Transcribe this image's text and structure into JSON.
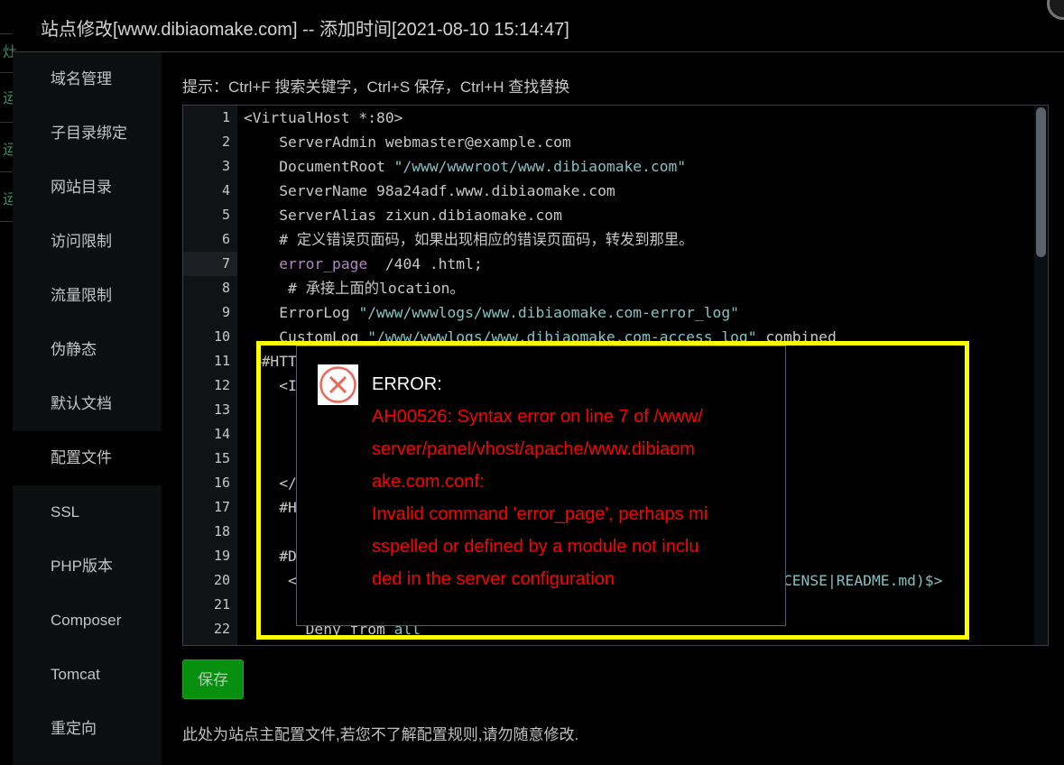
{
  "title": "站点修改[www.dibiaomake.com] -- 添加时间[2021-08-10 15:14:47]",
  "background_chars": [
    "灶",
    "运",
    "运",
    "运"
  ],
  "sidebar": {
    "active": "配置文件",
    "items": [
      {
        "label": "域名管理"
      },
      {
        "label": "子目录绑定"
      },
      {
        "label": "网站目录"
      },
      {
        "label": "访问限制"
      },
      {
        "label": "流量限制"
      },
      {
        "label": "伪静态"
      },
      {
        "label": "默认文档"
      },
      {
        "label": "配置文件"
      },
      {
        "label": "SSL"
      },
      {
        "label": "PHP版本"
      },
      {
        "label": "Composer"
      },
      {
        "label": "Tomcat"
      },
      {
        "label": "重定向"
      }
    ]
  },
  "hint": "提示：Ctrl+F 搜索关键字，Ctrl+S 保存，Ctrl+H 查找替换",
  "editor": {
    "current_line": 7,
    "lines": [
      {
        "n": "1",
        "parts": [
          [
            "<VirtualHost *:80>",
            ""
          ]
        ]
      },
      {
        "n": "2",
        "parts": [
          [
            "    ServerAdmin webmaster@example.com",
            ""
          ]
        ]
      },
      {
        "n": "3",
        "parts": [
          [
            "    DocumentRoot ",
            ""
          ],
          [
            "\"/www/wwwroot/www.dibiaomake.com\"",
            "str"
          ]
        ]
      },
      {
        "n": "4",
        "parts": [
          [
            "    ServerName 98a24adf.www.dibiaomake.com",
            ""
          ]
        ]
      },
      {
        "n": "5",
        "parts": [
          [
            "    ServerAlias zixun.dibiaomake.com",
            ""
          ]
        ]
      },
      {
        "n": "6",
        "parts": [
          [
            "    # 定义错误页面码，如果出现相应的错误页面码，转发到那里。",
            ""
          ]
        ]
      },
      {
        "n": "7",
        "parts": [
          [
            "    ",
            ""
          ],
          [
            "error_page",
            "kw"
          ],
          [
            "  /404 .html;",
            ""
          ]
        ]
      },
      {
        "n": "8",
        "parts": [
          [
            "     # 承接上面的location。",
            ""
          ]
        ]
      },
      {
        "n": "9",
        "parts": [
          [
            "    ErrorLog ",
            ""
          ],
          [
            "\"/www/wwwlogs/www.dibiaomake.com-error_log\"",
            "str"
          ]
        ]
      },
      {
        "n": "10",
        "parts": [
          [
            "    CustomLog ",
            ""
          ],
          [
            "\"/www/wwwlogs/www.dibiaomake.com-access_log\"",
            "str"
          ],
          [
            " combined",
            ""
          ]
        ]
      },
      {
        "n": "11",
        "parts": [
          [
            "  #HTT",
            ""
          ]
        ]
      },
      {
        "n": "12",
        "parts": [
          [
            "    <I",
            ""
          ]
        ]
      },
      {
        "n": "13",
        "parts": [
          [
            "",
            ""
          ]
        ]
      },
      {
        "n": "14",
        "parts": [
          [
            "",
            ""
          ]
        ]
      },
      {
        "n": "15",
        "parts": [
          [
            "",
            ""
          ]
        ]
      },
      {
        "n": "16",
        "parts": [
          [
            "    </",
            ""
          ]
        ]
      },
      {
        "n": "17",
        "parts": [
          [
            "    #H",
            ""
          ]
        ]
      },
      {
        "n": "18",
        "parts": [
          [
            "",
            ""
          ]
        ]
      },
      {
        "n": "19",
        "parts": [
          [
            "    #D",
            ""
          ]
        ]
      },
      {
        "n": "20",
        "parts": [
          [
            "     <                                                       ",
            ""
          ],
          [
            "CENSE|README.md)$>",
            "str"
          ]
        ]
      },
      {
        "n": "21",
        "parts": [
          [
            "",
            ""
          ]
        ]
      },
      {
        "n": "22",
        "parts": [
          [
            "       Deny from ",
            ""
          ],
          [
            "all",
            "str"
          ]
        ]
      }
    ]
  },
  "error": {
    "icon": "error-x-circle-icon",
    "title": "ERROR:",
    "lines": [
      "AH00526: Syntax error on line 7 of /www/",
      "server/panel/vhost/apache/www.dibiaom",
      "ake.com.conf:",
      "Invalid command 'error_page', perhaps mi",
      "sspelled or defined by a module not inclu",
      "ded in the server configuration"
    ],
    "color": "#ff0000",
    "highlight_color": "#ffff00"
  },
  "save_label": "保存",
  "save_color": "#07900f",
  "note": "此处为站点主配置文件,若您不了解配置规则,请勿随意修改."
}
